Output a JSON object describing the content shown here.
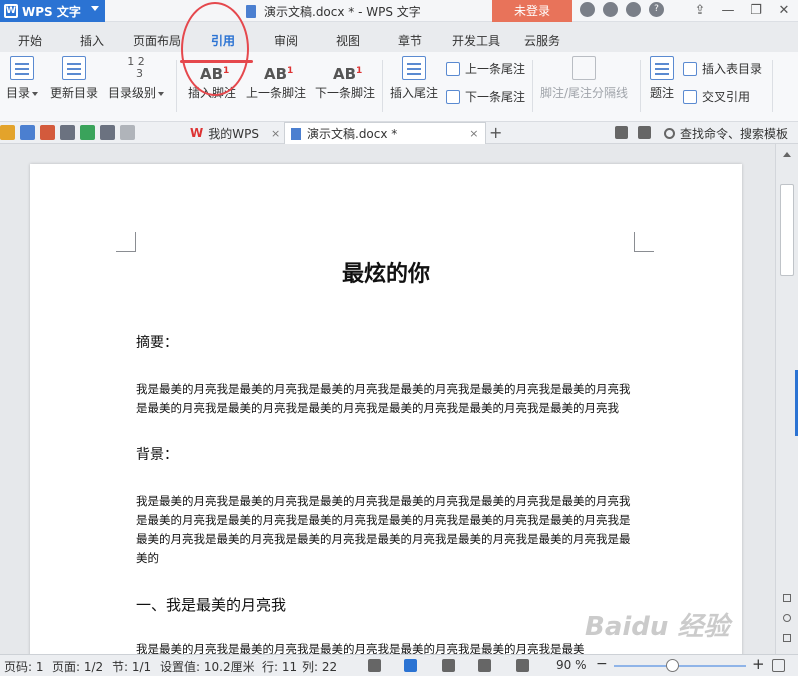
{
  "app": {
    "name": "WPS 文字",
    "window_title": "演示文稿.docx * - WPS 文字",
    "login_label": "未登录"
  },
  "ribbon_tabs": [
    "开始",
    "插入",
    "页面布局",
    "引用",
    "审阅",
    "视图",
    "章节",
    "开发工具",
    "云服务"
  ],
  "active_tab": "引用",
  "ribbon": {
    "toc": "目录",
    "update_toc": "更新目录",
    "toc_level": "目录级别",
    "insert_footnote": "插入脚注",
    "prev_footnote": "上一条脚注",
    "next_footnote": "下一条脚注",
    "insert_endnote": "插入尾注",
    "prev_endnote": "上一条尾注",
    "next_endnote": "下一条尾注",
    "separator": "脚注/尾注分隔线",
    "caption": "题注",
    "insert_table_of_figures": "插入表目录",
    "cross_reference": "交叉引用",
    "ab_glyph": "AB",
    "footnote_mark": "1"
  },
  "doc_tabs": {
    "home": "我的WPS",
    "current": "演示文稿.docx *",
    "close": "×",
    "add": "+"
  },
  "search_label": "查找命令、搜索模板",
  "document": {
    "title": "最炫的你",
    "abstract_heading": "摘要：",
    "abstract_text": "我是最美的月亮我是最美的月亮我是最美的月亮我是最美的月亮我是最美的月亮我是最美的月亮我是最美的月亮我是最美的月亮我是最美的月亮我是最美的月亮我是最美的月亮我是最美的月亮我",
    "background_heading": "背景：",
    "background_text": "我是最美的月亮我是最美的月亮我是最美的月亮我是最美的月亮我是最美的月亮我是最美的月亮我是最美的月亮我是最美的月亮我是最美的月亮我是最美的月亮我是最美的月亮我是最美的月亮我是最美的月亮我是最美的月亮我是最美的月亮我是最美的月亮我是最美的月亮我是最美的月亮我是最美的",
    "section1_heading": "一、我是最美的月亮我",
    "section1_text": "我是最美的月亮我是最美的月亮我是最美的月亮我是最美的月亮我是最美的月亮我是最美"
  },
  "status": {
    "page_code": "页码: 1",
    "page": "页面: 1/2",
    "section": "节: 1/1",
    "position": "设置值: 10.2厘米",
    "row": "行: 11",
    "col": "列: 22",
    "zoom": "90 %",
    "zoom_minus": "−",
    "zoom_plus": "+"
  },
  "watermark": "Baidu 经验",
  "colors": {
    "accent": "#2b73d3",
    "login": "#e8735a",
    "annotation": "#e5484d"
  }
}
